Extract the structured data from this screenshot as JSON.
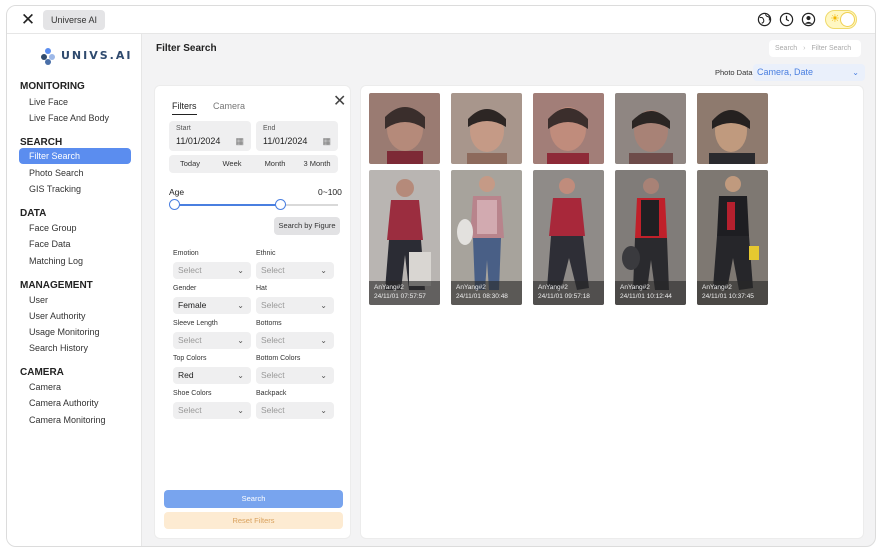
{
  "app": {
    "tab_label": "Universe AI"
  },
  "sidebar": {
    "logo_text": "UNIVS.AI",
    "sections": [
      {
        "title": "MONITORING",
        "items": [
          "Live Face",
          "Live Face And Body"
        ]
      },
      {
        "title": "SEARCH",
        "items": [
          "Filter Search",
          "Photo Search",
          "GIS Tracking"
        ]
      },
      {
        "title": "DATA",
        "items": [
          "Face Group",
          "Face Data",
          "Matching Log"
        ]
      },
      {
        "title": "MANAGEMENT",
        "items": [
          "User",
          "User Authority",
          "Usage Monitoring",
          "Search History"
        ]
      },
      {
        "title": "CAMERA",
        "items": [
          "Camera",
          "Camera Authority",
          "Camera Monitoring"
        ]
      }
    ],
    "active_item": "Filter Search"
  },
  "header": {
    "page_title": "Filter Search",
    "breadcrumb": [
      "Search",
      "Filter Search"
    ],
    "photo_data_label": "Photo Data",
    "photo_data_value": "Camera, Date"
  },
  "filters": {
    "tabs": [
      "Filters",
      "Camera"
    ],
    "start_label": "Start",
    "start_value": "11/01/2024",
    "end_label": "End",
    "end_value": "11/01/2024",
    "quick_ranges": [
      "Today",
      "Week",
      "Month",
      "3 Month"
    ],
    "age_label": "Age",
    "age_range": "0~100",
    "age_min_fraction": 0,
    "age_max_fraction": 0.65,
    "search_by_figure": "Search by Figure",
    "fields": [
      {
        "label": "Emotion",
        "value": "Select"
      },
      {
        "label": "Ethnic",
        "value": "Select"
      },
      {
        "label": "Gender",
        "value": "Female"
      },
      {
        "label": "Hat",
        "value": "Select"
      },
      {
        "label": "Sleeve Length",
        "value": "Select"
      },
      {
        "label": "Bottoms",
        "value": "Select"
      },
      {
        "label": "Top Colors",
        "value": "Red"
      },
      {
        "label": "Bottom Colors",
        "value": "Select"
      },
      {
        "label": "Shoe Colors",
        "value": "Select"
      },
      {
        "label": "Backpack",
        "value": "Select"
      }
    ],
    "search_button": "Search",
    "reset_button": "Reset Filters"
  },
  "results": [
    {
      "camera": "AnYang#2",
      "time": "24/11/01 07:57:57"
    },
    {
      "camera": "AnYang#2",
      "time": "24/11/01 08:30:48"
    },
    {
      "camera": "AnYang#2",
      "time": "24/11/01 09:57:18"
    },
    {
      "camera": "AnYang#2",
      "time": "24/11/01 10:12:44"
    },
    {
      "camera": "AnYang#2",
      "time": "24/11/01 10:37:45"
    }
  ],
  "colors": {
    "accent": "#5b8def",
    "search_button": "#78a4ee",
    "reset_button": "#fdebd2"
  }
}
